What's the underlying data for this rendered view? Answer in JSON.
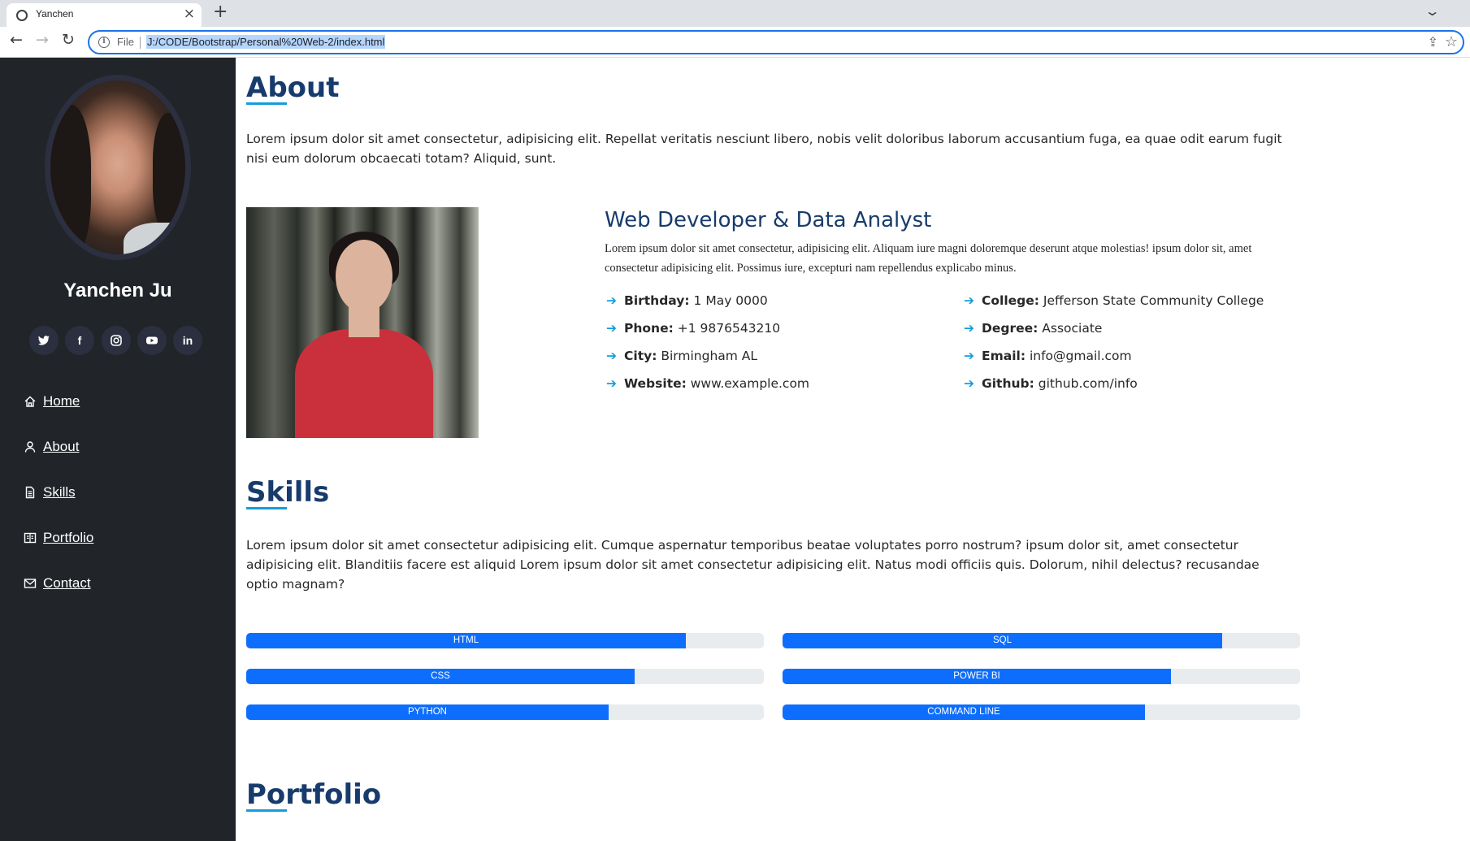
{
  "browser": {
    "tab_title": "Yanchen",
    "file_label": "File",
    "url": "J:/CODE/Bootstrap/Personal%20Web-2/index.html"
  },
  "sidebar": {
    "name": "Yanchen Ju",
    "social": [
      "twitter-icon",
      "facebook-icon",
      "instagram-icon",
      "youtube-icon",
      "linkedin-icon"
    ],
    "nav": [
      {
        "label": "Home",
        "icon": "home-icon"
      },
      {
        "label": "About",
        "icon": "person-icon"
      },
      {
        "label": "Skills",
        "icon": "file-icon"
      },
      {
        "label": "Portfolio",
        "icon": "book-icon"
      },
      {
        "label": "Contact",
        "icon": "envelope-icon"
      }
    ]
  },
  "about": {
    "title": "About",
    "intro": "Lorem ipsum dolor sit amet consectetur, adipisicing elit. Repellat veritatis nesciunt libero, nobis velit doloribus laborum accusantium fuga, ea quae odit earum fugit nisi eum dolorum obcaecati totam? Aliquid, sunt.",
    "role": "Web Developer & Data Analyst",
    "role_desc": "Lorem ipsum dolor sit amet consectetur, adipisicing elit. Aliquam iure magni doloremque deserunt atque molestias! ipsum dolor sit, amet consectetur adipisicing elit. Possimus iure, excepturi nam repellendus explicabo minus.",
    "info_left": [
      {
        "label": "Birthday:",
        "value": "1 May 0000"
      },
      {
        "label": "Phone:",
        "value": "+1 9876543210"
      },
      {
        "label": "City:",
        "value": "Birmingham AL"
      },
      {
        "label": "Website:",
        "value": "www.example.com"
      }
    ],
    "info_right": [
      {
        "label": "College:",
        "value": "Jefferson State Community College"
      },
      {
        "label": "Degree:",
        "value": "Associate"
      },
      {
        "label": "Email:",
        "value": "info@gmail.com"
      },
      {
        "label": "Github:",
        "value": "github.com/info"
      }
    ]
  },
  "skills": {
    "title": "Skills",
    "intro": "Lorem ipsum dolor sit amet consectetur adipisicing elit. Cumque aspernatur temporibus beatae voluptates porro nostrum? ipsum dolor sit, amet consectetur adipisicing elit. Blanditiis facere est aliquid Lorem ipsum dolor sit amet consectetur adipisicing elit. Natus modi officiis quis. Dolorum, nihil delectus? recusandae optio magnam?",
    "bars_left": [
      {
        "label": "HTML",
        "percent": 85
      },
      {
        "label": "CSS",
        "percent": 75
      },
      {
        "label": "PYTHON",
        "percent": 70
      }
    ],
    "bars_right": [
      {
        "label": "SQL",
        "percent": 85
      },
      {
        "label": "POWER BI",
        "percent": 75
      },
      {
        "label": "COMMAND LINE",
        "percent": 70
      }
    ]
  },
  "portfolio": {
    "title": "Portfolio"
  },
  "colors": {
    "sidebar_bg": "#212529",
    "heading": "#173b6c",
    "accent": "#149ddd",
    "bar": "#0d6efd"
  }
}
